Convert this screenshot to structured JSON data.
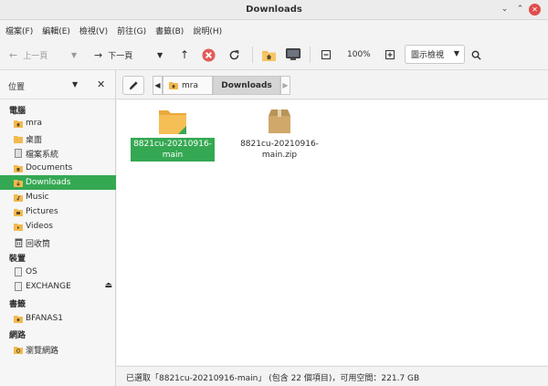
{
  "window": {
    "title": "Downloads"
  },
  "menu": [
    "檔案(F)",
    "編輯(E)",
    "檢視(V)",
    "前往(G)",
    "書籤(B)",
    "說明(H)"
  ],
  "toolbar": {
    "back_label": "上一頁",
    "forward_label": "下一頁",
    "zoom": "100%",
    "view_mode": "圖示檢視"
  },
  "sidebar": {
    "header": "位置",
    "sections": [
      {
        "title": "電腦",
        "items": [
          "mra",
          "桌面",
          "檔案系統",
          "Documents",
          "Downloads",
          "Music",
          "Pictures",
          "Videos",
          "回收筒"
        ]
      },
      {
        "title": "裝置",
        "items": [
          "OS",
          "EXCHANGE"
        ]
      },
      {
        "title": "書籤",
        "items": [
          "BFANAS1"
        ]
      },
      {
        "title": "網路",
        "items": [
          "瀏覽網路"
        ]
      }
    ],
    "active_item": "Downloads"
  },
  "path": {
    "parent": "mra",
    "current": "Downloads"
  },
  "files": [
    {
      "name_line1": "8821cu-20210916-",
      "name_line2": "main",
      "type": "folder",
      "selected": true
    },
    {
      "name_line1": "8821cu-20210916-",
      "name_line2": "main.zip",
      "type": "archive",
      "selected": false
    }
  ],
  "status": "已選取「8821cu-20210916-main」 (包含 22 個項目)，可用空間：221.7 GB",
  "colors": {
    "accent": "#35a853",
    "folder": "#f2b94f",
    "archive": "#c9a66b",
    "close": "#e24c4c"
  }
}
